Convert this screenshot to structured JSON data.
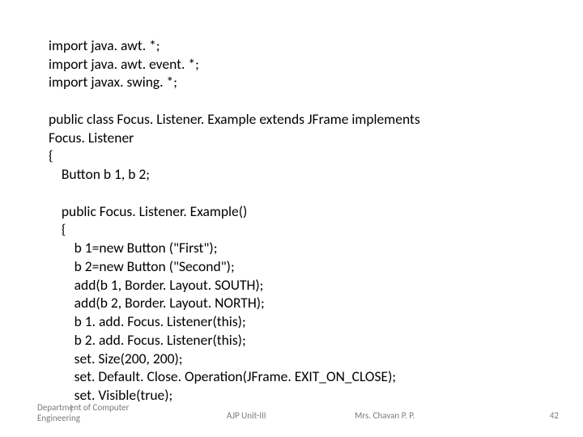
{
  "code": {
    "l1": "import java. awt. *;",
    "l2": "import java. awt. event. *;",
    "l3": "import javax. swing. *;",
    "l4": "",
    "l5": "public class Focus. Listener. Example extends JFrame implements",
    "l6": "Focus. Listener",
    "l7": "{",
    "l8": "    Button b 1, b 2;",
    "l9": "",
    "l10": "    public Focus. Listener. Example()",
    "l11": "    {",
    "l12": "        b 1=new Button (\"First\");",
    "l13": "        b 2=new Button (\"Second\");",
    "l14": "        add(b 1, Border. Layout. SOUTH);",
    "l15": "        add(b 2, Border. Layout. NORTH);",
    "l16": "        b 1. add. Focus. Listener(this);",
    "l17": "        b 2. add. Focus. Listener(this);",
    "l18": "        set. Size(200, 200);",
    "l19": "        set. Default. Close. Operation(JFrame. EXIT_ON_CLOSE);",
    "l20": "        set. Visible(true);"
  },
  "footer": {
    "closebrace": "}",
    "dept_line1": "Department of Computer",
    "dept_line2": "Engineering",
    "center": "AJP Unit-III",
    "author": "Mrs. Chavan P. P.",
    "page": "42"
  }
}
